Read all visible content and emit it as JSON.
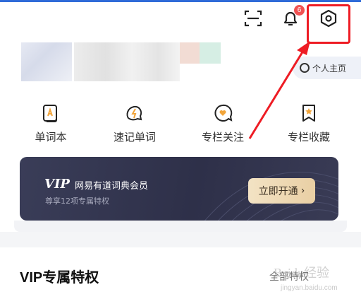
{
  "header": {
    "notification_count": "6",
    "icons": [
      "scan-icon",
      "bell-icon",
      "settings-hexagon-icon"
    ],
    "highlight_color": "#ee1c24"
  },
  "profile": {
    "homepage_label": "个人主页"
  },
  "quick_actions": [
    {
      "label": "单词本",
      "icon": "wordbook-icon"
    },
    {
      "label": "速记单词",
      "icon": "quick-memo-icon"
    },
    {
      "label": "专栏关注",
      "icon": "column-follow-icon"
    },
    {
      "label": "专栏收藏",
      "icon": "column-collect-icon"
    }
  ],
  "vip_card": {
    "logo": "VIP",
    "title": "网易有道词典会员",
    "subtitle": "尊享12项专属特权",
    "button_label": "立即开通",
    "button_chevron": "›"
  },
  "section": {
    "title": "VIP专属特权",
    "more_label": "全部特权"
  },
  "watermark": {
    "text": "Baidu经验",
    "sub": "jingyan.baidu.com"
  },
  "colors": {
    "accent_blue": "#2f6bd8",
    "icon_orange": "#f2a53a",
    "vip_bg": "#2e3049",
    "vip_button_gold": "#e9cfa4",
    "annotation_red": "#ee1c24"
  }
}
